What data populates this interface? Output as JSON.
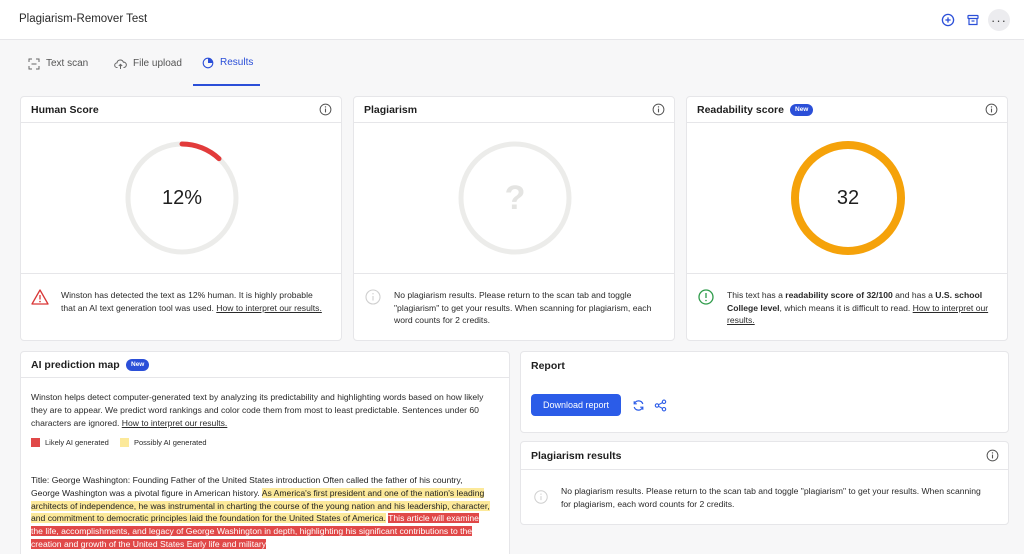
{
  "app": {
    "title": "Plagiarism-Remover Test"
  },
  "tabs": [
    {
      "label": "Text scan",
      "icon": "scan-icon"
    },
    {
      "label": "File upload",
      "icon": "cloud-upload-icon"
    },
    {
      "label": "Results",
      "icon": "results-icon",
      "active": true
    }
  ],
  "human_score": {
    "title": "Human Score",
    "value_text": "12%",
    "value": 12,
    "message_prefix": "Winston has detected the text as 12% human. It is highly probable that an AI text generation tool was used. ",
    "link": "How to interpret our results."
  },
  "plagiarism": {
    "title": "Plagiarism",
    "placeholder": "?",
    "message": "No plagiarism results. Please return to the scan tab and toggle \"plagiarism\" to get your results. When scanning for plagiarism, each word counts for 2 credits."
  },
  "readability": {
    "title": "Readability score",
    "badge": "New",
    "value_text": "32",
    "value": 32,
    "msg_1": "This text has a ",
    "msg_bold_1": "readability score of 32/100",
    "msg_2": " and has a ",
    "msg_bold_2": "U.S. school College level",
    "msg_3": ", which means it is difficult to read. ",
    "link": "How to interpret our results."
  },
  "ai_map": {
    "title": "AI prediction map",
    "badge": "New",
    "desc": "Winston helps detect computer-generated text by analyzing its predictability and highlighting words based on how likely they are to appear. We predict word rankings and color code them from most to least predictable. Sentences under 60 characters are ignored. ",
    "desc_link": "How to interpret our results.",
    "legend_likely": "Likely AI generated",
    "legend_possibly": "Possibly AI generated",
    "text_plain": "Title: George Washington: Founding Father of the United States introduction Often called the father of his country, George Washington was a pivotal figure in American history. ",
    "text_yellow": "As America's first president and one of the nation's leading architects of independence, he was instrumental in charting the course of the young nation and his leadership, character, and commitment to democratic principles laid the foundation for the United States of America.",
    "text_red": "This article will examine the life, accomplishments, and legacy of George Washington in depth, highlighting his significant contributions to the creation and growth of the United States Early life and military"
  },
  "report": {
    "title": "Report",
    "download_label": "Download report"
  },
  "plagiarism_results": {
    "title": "Plagiarism results",
    "message": "No plagiarism results. Please return to the scan tab and toggle \"plagiarism\" to get your results. When scanning for plagiarism, each word counts for 2 credits."
  },
  "colors": {
    "accent": "#2b4fd8",
    "human_arc": "#e23b3b",
    "readability_ring": "#f5a20a",
    "ring_track": "#ececea",
    "likely_ai": "#e04848",
    "possibly_ai": "#fce99a"
  }
}
